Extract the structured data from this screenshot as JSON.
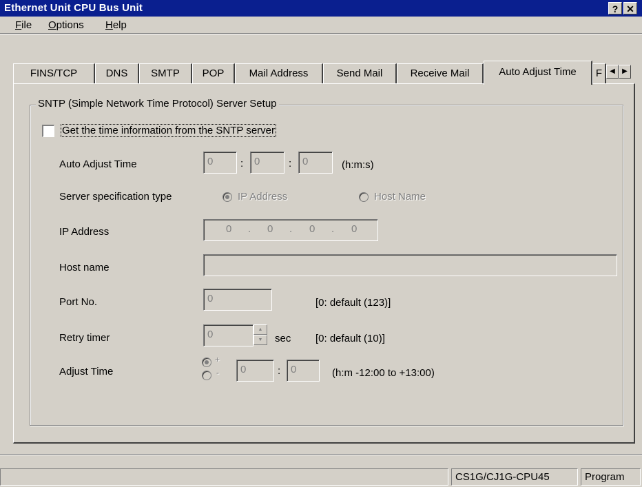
{
  "window": {
    "title": "Ethernet Unit CPU Bus Unit",
    "help_button": "?",
    "close_button": "✕"
  },
  "menu": {
    "file": "File",
    "options": "Options",
    "help": "Help"
  },
  "tabs": [
    {
      "label": "FINS/TCP"
    },
    {
      "label": "DNS"
    },
    {
      "label": "SMTP"
    },
    {
      "label": "POP"
    },
    {
      "label": "Mail Address"
    },
    {
      "label": "Send Mail"
    },
    {
      "label": "Receive Mail"
    },
    {
      "label": "Auto Adjust Time"
    },
    {
      "label": "F"
    }
  ],
  "active_tab": "Auto Adjust Time",
  "group": {
    "title": "SNTP (Simple Network Time Protocol) Server Setup",
    "get_time_checkbox_label": "Get the time information from the SNTP server",
    "get_time_checked": false,
    "auto_adjust_time": {
      "label": "Auto Adjust Time",
      "h": "0",
      "m": "0",
      "s": "0",
      "sep1": ":",
      "sep2": ":",
      "unit": "(h:m:s)"
    },
    "server_spec": {
      "label": "Server specification type",
      "option_ip": "IP Address",
      "option_host": "Host Name",
      "selected": "IP Address"
    },
    "ip_address": {
      "label": "IP Address",
      "octets": [
        "0",
        "0",
        "0",
        "0"
      ],
      "dot": "."
    },
    "host_name": {
      "label": "Host name",
      "value": ""
    },
    "port": {
      "label": "Port No.",
      "value": "0",
      "hint": "[0: default (123)]"
    },
    "retry": {
      "label": "Retry timer",
      "value": "0",
      "unit": "sec",
      "hint": "[0: default (10)]"
    },
    "adjust_time": {
      "label": "Adjust Time",
      "plus": "+",
      "minus": "-",
      "selected": "+",
      "h": "0",
      "m": "0",
      "sep": ":",
      "hint": "(h:m  -12:00 to +13:00)"
    }
  },
  "status": {
    "model": "CS1G/CJ1G-CPU45",
    "mode": "Program"
  },
  "colors": {
    "titlebar": "#0a1f8f",
    "face": "#d4d0c8",
    "disabled_text": "#808080"
  }
}
